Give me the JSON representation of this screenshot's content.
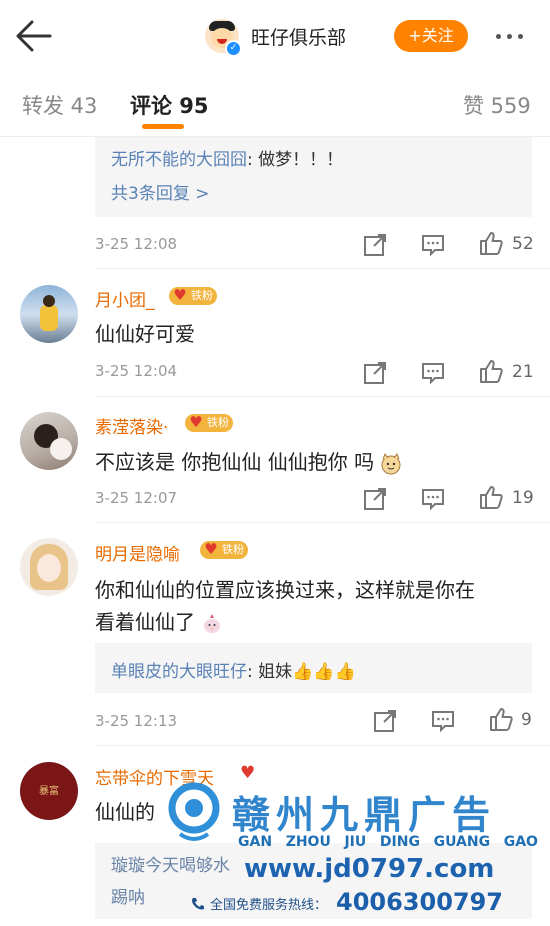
{
  "header": {
    "account_name": "旺仔俱乐部",
    "follow_label": "+关注",
    "icons": {
      "back": "arrow-left-icon",
      "more": "more-dots-icon",
      "verified": "verified-badge-icon"
    }
  },
  "tabs": [
    {
      "label": "转发 43"
    },
    {
      "label": "评论 95"
    },
    {
      "label": "赞 559"
    }
  ],
  "first_block": {
    "reply_name": "无所不能的大囧囧",
    "reply_text": ": 做梦！！！",
    "more_replies": "共3条回复 >",
    "time": "3-25 12:08",
    "likes": "52"
  },
  "comments": [
    {
      "user": "月小团_",
      "badge": "铁粉",
      "text": "仙仙好可爱",
      "time": "3-25 12:04",
      "likes": "21"
    },
    {
      "user": "素滢落染·",
      "badge": "铁粉",
      "text": "不应该是 你抱仙仙 仙仙抱你 吗",
      "time": "3-25 12:07",
      "likes": "19"
    },
    {
      "user": "明月是隐喻",
      "badge": "铁粉",
      "text_line1": "你和仙仙的位置应该换过来，这样就是你在",
      "text_line2": "看着仙仙了",
      "reply_name": "单眼皮的大眼旺仔",
      "reply_text": ": 姐妹",
      "time": "3-25 12:13",
      "likes": "9"
    },
    {
      "user": "忘带伞的下雪天",
      "avatar_text": "暴富",
      "text_partial": "仙仙的",
      "reply_line1": "璇璇今天喝够水",
      "reply_line2": "踢呐"
    }
  ],
  "watermark": {
    "brand_cn": "赣州九鼎广告",
    "pinyin": [
      "GAN",
      "ZHOU",
      "JIU",
      "DING",
      "GUANG",
      "GAO"
    ],
    "url": "www.jd0797.com",
    "hotline_label": "全国免费服务热线：",
    "phone": "4006300797"
  }
}
